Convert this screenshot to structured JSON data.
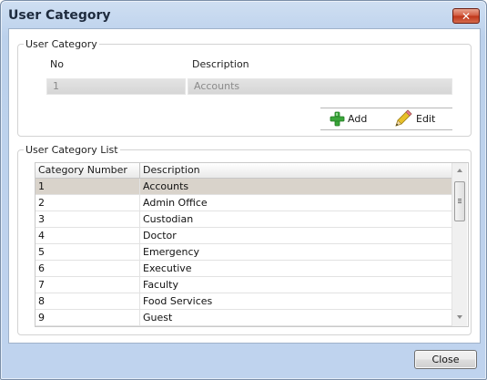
{
  "window": {
    "title": "User Category",
    "close_glyph": "✕"
  },
  "user_category": {
    "legend": "User Category",
    "no_label": "No",
    "description_label": "Description",
    "no_value": "1",
    "description_value": "Accounts",
    "add_label": "Add",
    "edit_label": "Edit"
  },
  "list": {
    "legend": "User Category List",
    "columns": [
      "Category Number",
      "Description"
    ],
    "rows": [
      {
        "number": "1",
        "description": "Accounts",
        "selected": true
      },
      {
        "number": "2",
        "description": "Admin Office",
        "selected": false
      },
      {
        "number": "3",
        "description": "Custodian",
        "selected": false
      },
      {
        "number": "4",
        "description": "Doctor",
        "selected": false
      },
      {
        "number": "5",
        "description": "Emergency",
        "selected": false
      },
      {
        "number": "6",
        "description": "Executive",
        "selected": false
      },
      {
        "number": "7",
        "description": "Faculty",
        "selected": false
      },
      {
        "number": "8",
        "description": "Food Services",
        "selected": false
      },
      {
        "number": "9",
        "description": "Guest",
        "selected": false
      }
    ]
  },
  "footer": {
    "close_label": "Close"
  },
  "colors": {
    "selected_row": "#d9d3cb",
    "close_button_red": "#c9452a",
    "add_icon_green": "#3aa63a",
    "pencil_yellow": "#e8c02a"
  },
  "icons": {
    "add": "plus-icon",
    "edit": "pencil-icon",
    "window_close": "close-icon"
  }
}
